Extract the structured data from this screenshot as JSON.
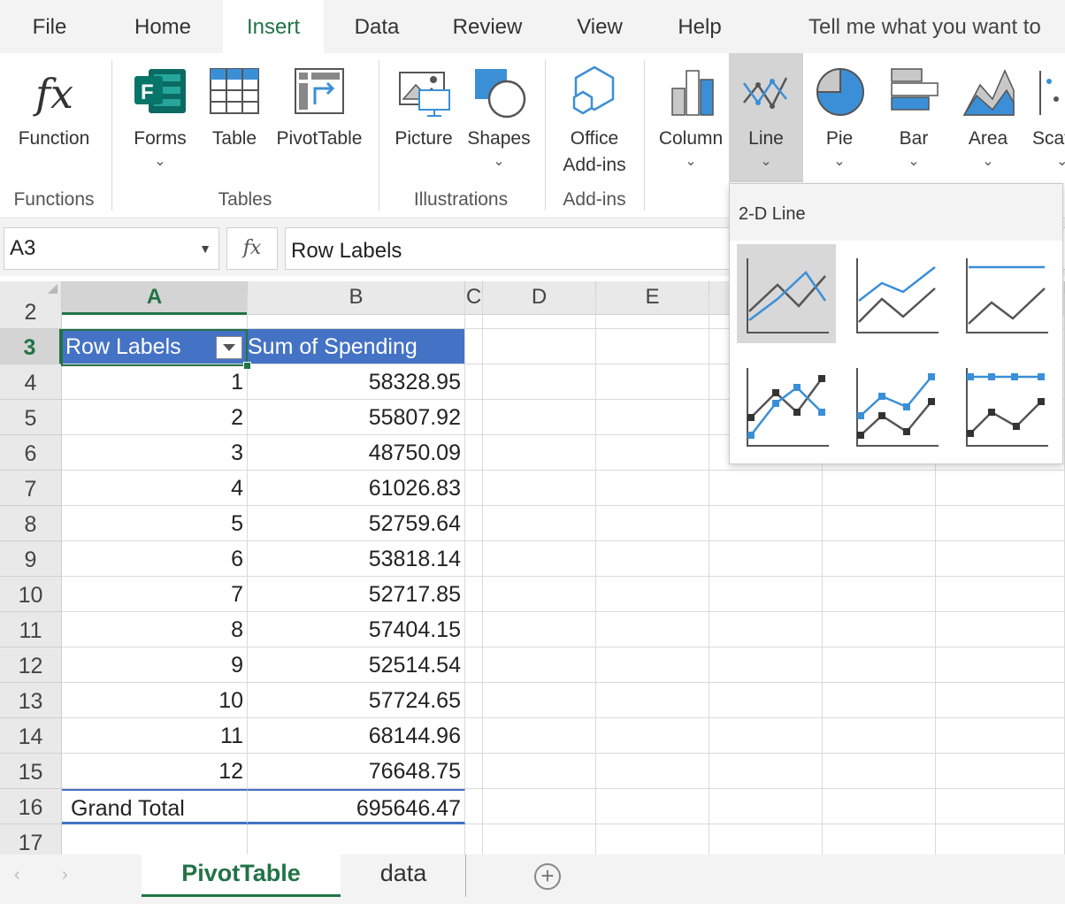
{
  "tabs": {
    "file": "File",
    "home": "Home",
    "insert": "Insert",
    "data": "Data",
    "review": "Review",
    "view": "View",
    "help": "Help",
    "tell_me": "Tell me what you want to"
  },
  "ribbon": {
    "function": "Function",
    "forms": "Forms",
    "table": "Table",
    "pivottable": "PivotTable",
    "picture": "Picture",
    "shapes": "Shapes",
    "office_addins_line1": "Office",
    "office_addins_line2": "Add-ins",
    "column": "Column",
    "line": "Line",
    "pie": "Pie",
    "bar": "Bar",
    "area": "Area",
    "scatter": "Scat",
    "groups": {
      "functions": "Functions",
      "tables": "Tables",
      "illustrations": "Illustrations",
      "addins": "Add-ins"
    },
    "accent_green": "#217346",
    "chart_blue": "#3b8fd6"
  },
  "formula_bar": {
    "name_box": "A3",
    "fx": "fx",
    "formula": "Row Labels"
  },
  "grid": {
    "columns": [
      "A",
      "B",
      "C",
      "D",
      "E"
    ],
    "row_headers": [
      "2",
      "3",
      "4",
      "5",
      "6",
      "7",
      "8",
      "9",
      "10",
      "11",
      "12",
      "13",
      "14",
      "15",
      "16",
      "17"
    ],
    "pivot": {
      "header_label": "Row Labels",
      "header_value": "Sum of Spending",
      "header_color": "#4472c4",
      "rows": [
        {
          "label": "1",
          "value": "58328.95"
        },
        {
          "label": "2",
          "value": "55807.92"
        },
        {
          "label": "3",
          "value": "48750.09"
        },
        {
          "label": "4",
          "value": "61026.83"
        },
        {
          "label": "5",
          "value": "52759.64"
        },
        {
          "label": "6",
          "value": "53818.14"
        },
        {
          "label": "7",
          "value": "52717.85"
        },
        {
          "label": "8",
          "value": "57404.15"
        },
        {
          "label": "9",
          "value": "52514.54"
        },
        {
          "label": "10",
          "value": "57724.65"
        },
        {
          "label": "11",
          "value": "68144.96"
        },
        {
          "label": "12",
          "value": "76648.75"
        }
      ],
      "grand_total_label": "Grand Total",
      "grand_total_value": "695646.47"
    }
  },
  "gallery": {
    "title": "2-D Line",
    "items": [
      "line-chart-icon",
      "stacked-line-chart-icon",
      "100-stacked-line-chart-icon",
      "line-with-markers-chart-icon",
      "stacked-line-with-markers-chart-icon",
      "100-stacked-line-with-markers-chart-icon"
    ]
  },
  "sheets": {
    "tabs": [
      "PivotTable",
      "data"
    ],
    "active": "PivotTable"
  }
}
